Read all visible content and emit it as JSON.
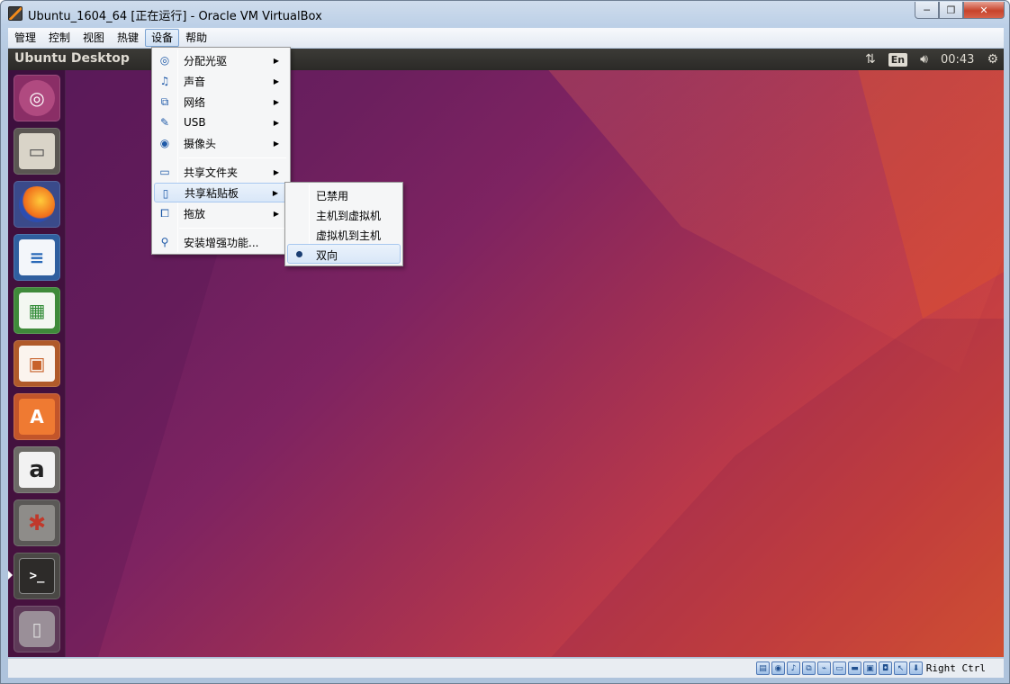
{
  "window": {
    "title": "Ubuntu_1604_64 [正在运行] - Oracle VM VirtualBox",
    "minimize_icon": "minimize-icon",
    "restore_icon": "restore-icon",
    "close_icon": "close-icon",
    "minimize_glyph": "─",
    "restore_glyph": "❐",
    "close_glyph": "✕"
  },
  "menubar": {
    "items": [
      "管理",
      "控制",
      "视图",
      "热键",
      "设备",
      "帮助"
    ],
    "active": "设备"
  },
  "devices_menu": {
    "items": [
      {
        "label": "分配光驱",
        "icon": "optical-disc-icon",
        "submenu": true
      },
      {
        "label": "声音",
        "icon": "audio-icon",
        "submenu": true
      },
      {
        "label": "网络",
        "icon": "network-icon",
        "submenu": true
      },
      {
        "label": "USB",
        "icon": "usb-icon",
        "submenu": true
      },
      {
        "label": "摄像头",
        "icon": "webcam-icon",
        "submenu": true
      },
      {
        "label": "共享文件夹",
        "icon": "shared-folder-icon",
        "submenu": true
      },
      {
        "label": "共享粘贴板",
        "icon": "clipboard-icon",
        "submenu": true,
        "highlighted": true
      },
      {
        "label": "拖放",
        "icon": "drag-drop-icon",
        "submenu": true
      },
      {
        "label": "安装增强功能...",
        "icon": "guest-additions-icon",
        "submenu": false
      }
    ]
  },
  "clipboard_submenu": {
    "items": [
      {
        "label": "已禁用",
        "selected": false
      },
      {
        "label": "主机到虚拟机",
        "selected": false
      },
      {
        "label": "虚拟机到主机",
        "selected": false
      },
      {
        "label": "双向",
        "selected": true
      }
    ]
  },
  "guest": {
    "panel_title": "Ubuntu Desktop",
    "keyboard_layout": "En",
    "clock": "00:43",
    "launcher": [
      {
        "name": "ubuntu-dash-icon",
        "glyph": "◎"
      },
      {
        "name": "files-icon",
        "glyph": "▭"
      },
      {
        "name": "firefox-icon",
        "glyph": "●"
      },
      {
        "name": "libreoffice-writer-icon",
        "glyph": "≡"
      },
      {
        "name": "libreoffice-calc-icon",
        "glyph": "▦"
      },
      {
        "name": "libreoffice-impress-icon",
        "glyph": "▣"
      },
      {
        "name": "ubuntu-software-icon",
        "glyph": "A"
      },
      {
        "name": "amazon-icon",
        "glyph": "a"
      },
      {
        "name": "system-settings-icon",
        "glyph": "✱"
      },
      {
        "name": "terminal-icon",
        "glyph": ">_"
      },
      {
        "name": "trash-icon",
        "glyph": "▯"
      }
    ]
  },
  "statusbar": {
    "host_key": "Right Ctrl",
    "icons": [
      "hard-disk-icon",
      "optical-disk-icon",
      "audio-icon",
      "network-icon",
      "usb-icon",
      "shared-folder-icon",
      "display-icon",
      "recording-icon",
      "cpu-icon",
      "mouse-integration-icon",
      "keyboard-icon"
    ]
  },
  "colors": {
    "panel": "#2b2a27",
    "menu_highlight": "#d9e7f8",
    "wallpaper_start": "#5a1c5c",
    "wallpaper_end": "#e25a2e"
  }
}
